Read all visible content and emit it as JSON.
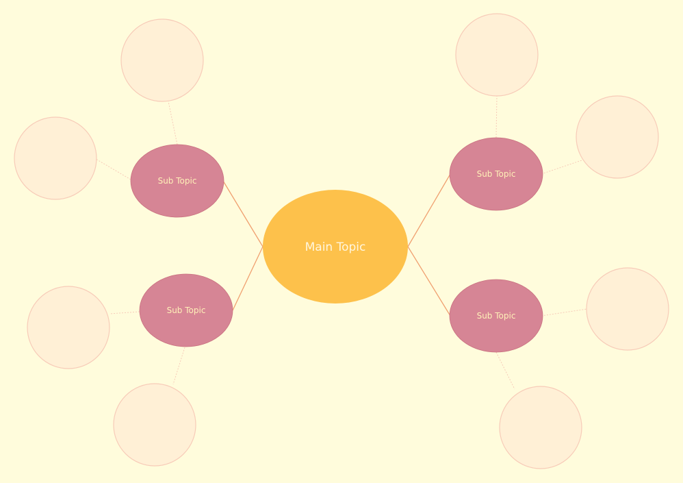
{
  "colors": {
    "background": "#fffcdc",
    "main_fill": "#fdc14b",
    "main_text": "#fff6de",
    "sub_fill": "#d68595",
    "sub_text": "#fff0b8",
    "leaf_fill": "#fff0d6",
    "leaf_stroke": "#f7cbb8",
    "connector": "#f0a070"
  },
  "main_topic": {
    "label": "Main Topic"
  },
  "sub_topics": [
    {
      "label": "Sub Topic"
    },
    {
      "label": "Sub Topic"
    },
    {
      "label": "Sub Topic"
    },
    {
      "label": "Sub Topic"
    }
  ]
}
